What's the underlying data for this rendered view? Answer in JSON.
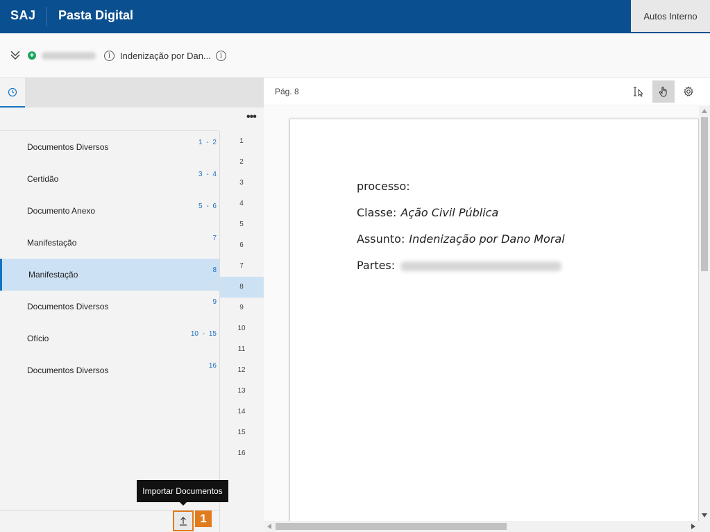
{
  "header": {
    "brand": "SAJ",
    "title": "Pasta Digital",
    "autos_button": "Autos Interno"
  },
  "process_bar": {
    "subject": "Indenização por Dan...",
    "plus_symbol": "+",
    "info_symbol": "i"
  },
  "left_panel": {
    "more_menu": "•••",
    "documents": [
      {
        "name": "Documentos Diversos",
        "pages": "1 - 2"
      },
      {
        "name": "Certidão",
        "pages": "3 - 4"
      },
      {
        "name": "Documento Anexo",
        "pages": "5 - 6"
      },
      {
        "name": "Manifestação",
        "pages": "7"
      },
      {
        "name": "Manifestação",
        "pages": "8"
      },
      {
        "name": "Documentos Diversos",
        "pages": "9"
      },
      {
        "name": "Ofício",
        "pages": "10 - 15"
      },
      {
        "name": "Documentos Diversos",
        "pages": "16"
      }
    ],
    "selected_document_index": 4,
    "page_numbers": [
      "1",
      "2",
      "3",
      "4",
      "5",
      "6",
      "7",
      "8",
      "9",
      "10",
      "11",
      "12",
      "13",
      "14",
      "15",
      "16"
    ],
    "selected_page": "8",
    "tooltip": "Importar Documentos",
    "step_badge": "1"
  },
  "viewer": {
    "page_label": "Pág. 8",
    "content": {
      "line1": "processo:",
      "classe_label": "Classe:",
      "classe_value": "Ação Civil Pública",
      "assunto_label": "Assunto:",
      "assunto_value": "Indenização por Dano Moral",
      "partes_label": "Partes:"
    }
  },
  "colors": {
    "header_bg": "#0a4f8f",
    "accent": "#1273c4",
    "selected_bg": "#cde1f4",
    "highlight": "#e07b1e",
    "add_green": "#1da462"
  }
}
